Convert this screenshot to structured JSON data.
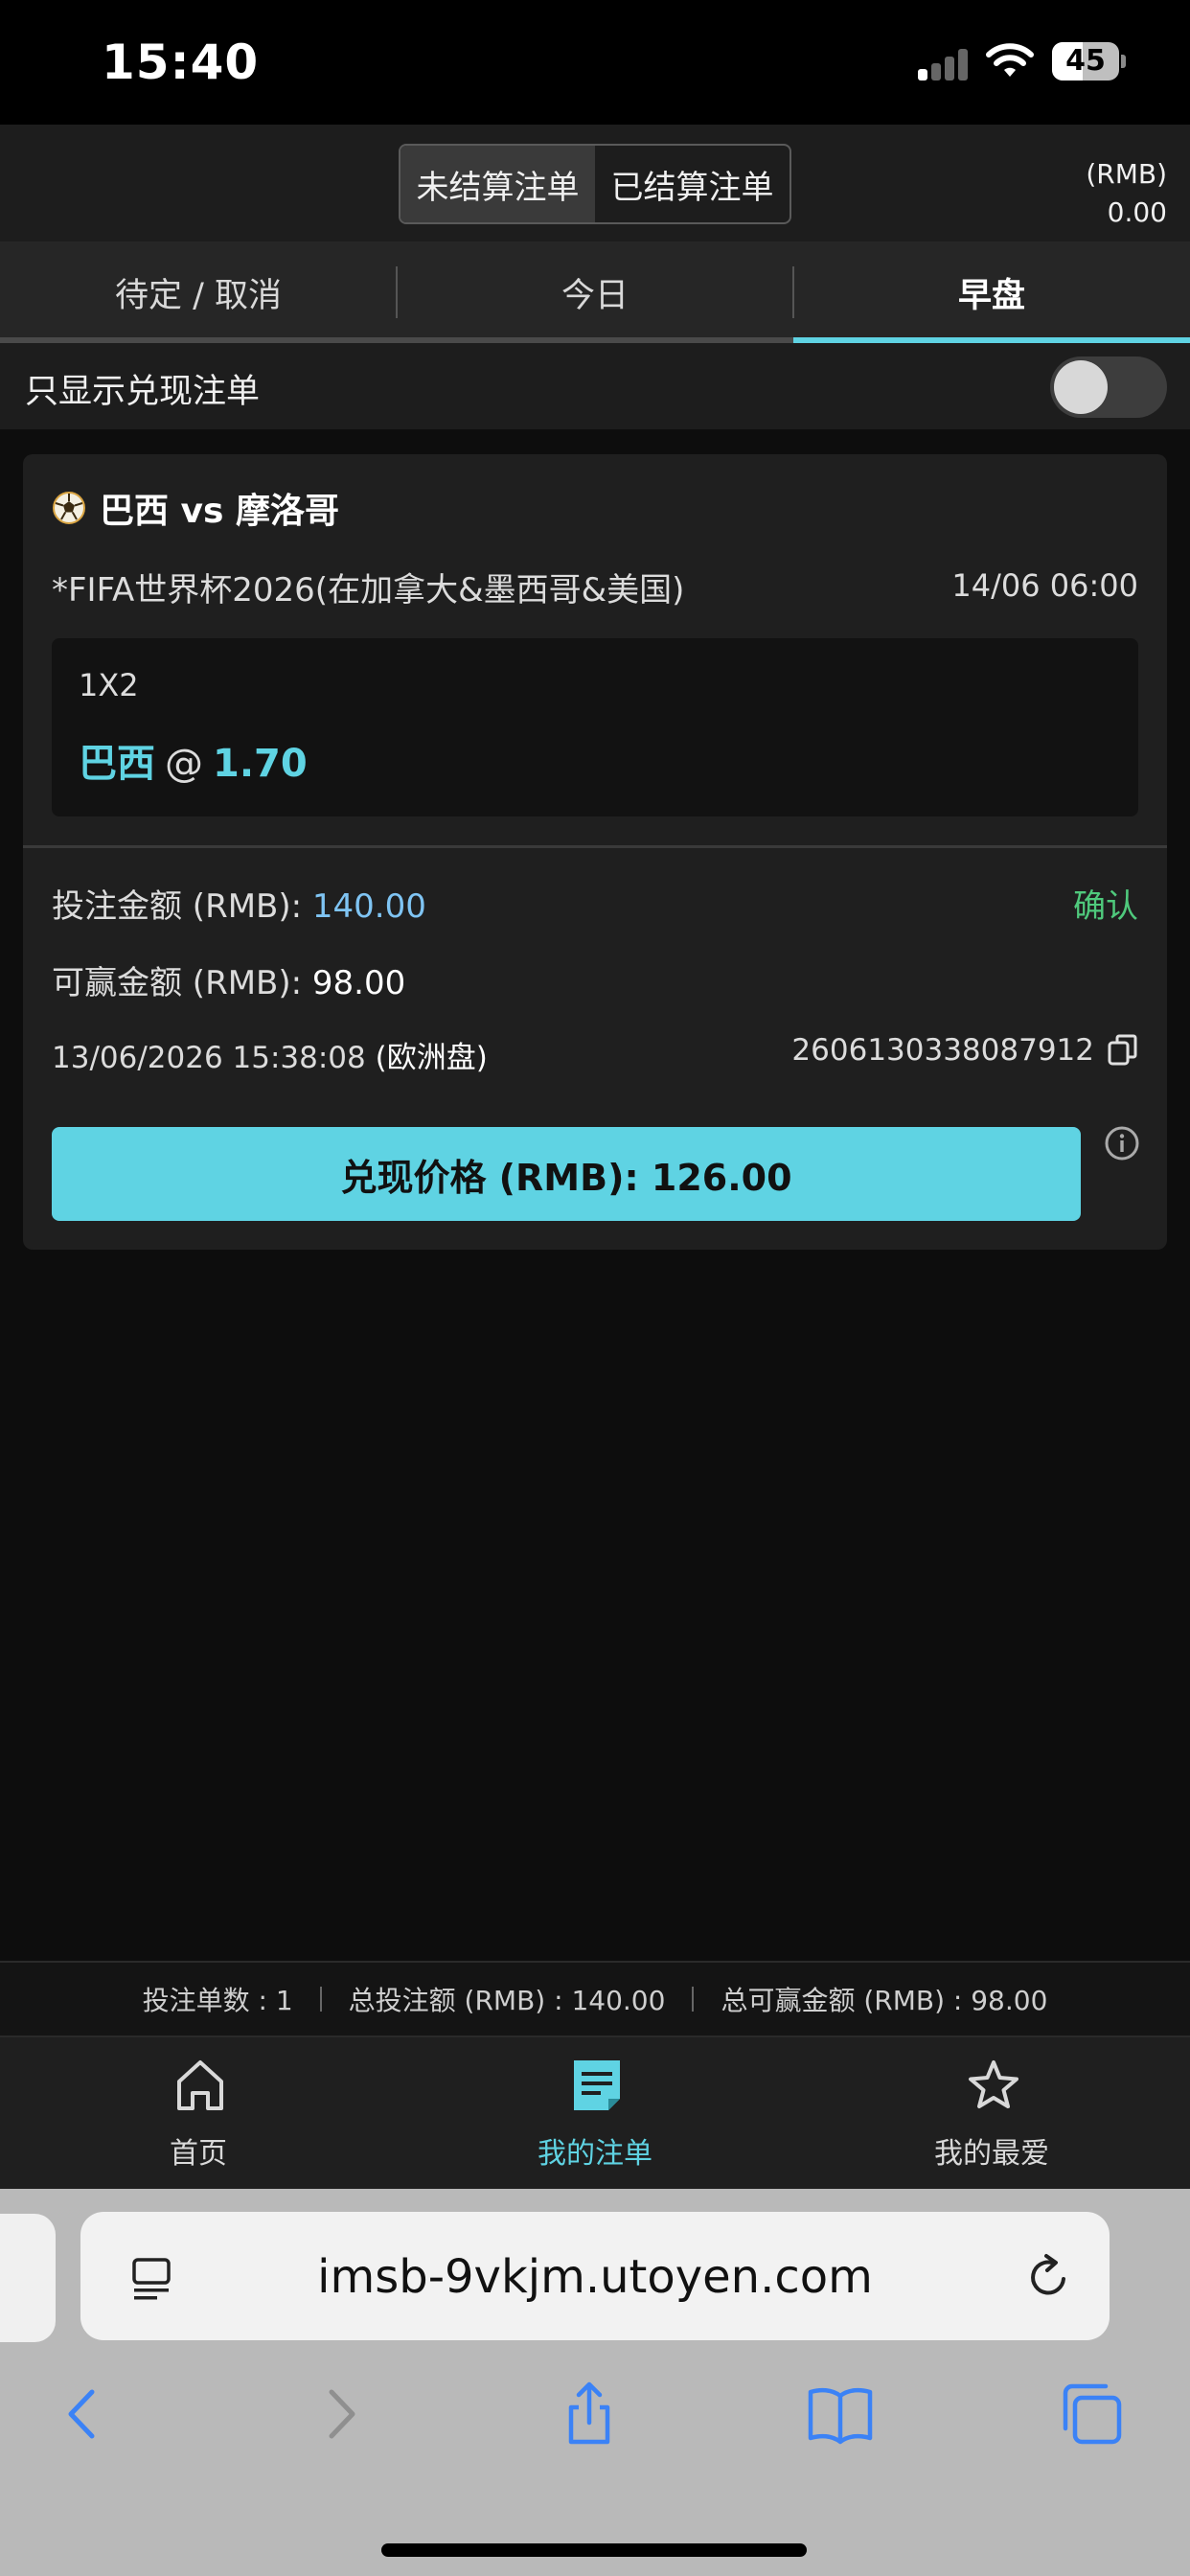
{
  "status_bar": {
    "time": "15:40",
    "battery": "45",
    "battery_level": 0.45
  },
  "header": {
    "segments": [
      {
        "label": "未结算注单",
        "active": true
      },
      {
        "label": "已结算注单",
        "active": false
      }
    ],
    "balance_currency": "(RMB)",
    "balance_value": "0.00"
  },
  "tabs": [
    {
      "label": "待定 / 取消",
      "active": false
    },
    {
      "label": "今日",
      "active": false
    },
    {
      "label": "早盘",
      "active": true
    }
  ],
  "filter": {
    "label": "只显示兑现注单",
    "toggle_on": false
  },
  "bet": {
    "match": "巴西 vs 摩洛哥",
    "league": "*FIFA世界杯2026(在加拿大&墨西哥&美国)",
    "kickoff": "14/06 06:00",
    "market": "1X2",
    "pick": "巴西",
    "at": "@",
    "odds": "1.70",
    "stake_label": "投注金额 (RMB):",
    "stake_value": "140.00",
    "status": "确认",
    "win_label": "可赢金额 (RMB):",
    "win_value": "98.00",
    "placed_time": "13/06/2026 15:38:08",
    "odds_type": "(欧洲盘)",
    "bet_id": "2606130338087912",
    "cashout_label": "兑现价格 (RMB): 126.00"
  },
  "summary": {
    "count": "投注单数 : 1",
    "total_stake": "总投注额 (RMB) : 140.00",
    "total_win": "总可赢金额 (RMB) : 98.00"
  },
  "bottom_nav": [
    {
      "label": "首页",
      "icon": "home-icon",
      "active": false
    },
    {
      "label": "我的注单",
      "icon": "betslip-icon",
      "active": true
    },
    {
      "label": "我的最爱",
      "icon": "star-icon",
      "active": false
    }
  ],
  "browser": {
    "url": "imsb-9vkjm.utoyen.com"
  },
  "colors": {
    "accent": "#5fd3e3",
    "confirm": "#4fc97c",
    "stake": "#7fc4f3"
  }
}
